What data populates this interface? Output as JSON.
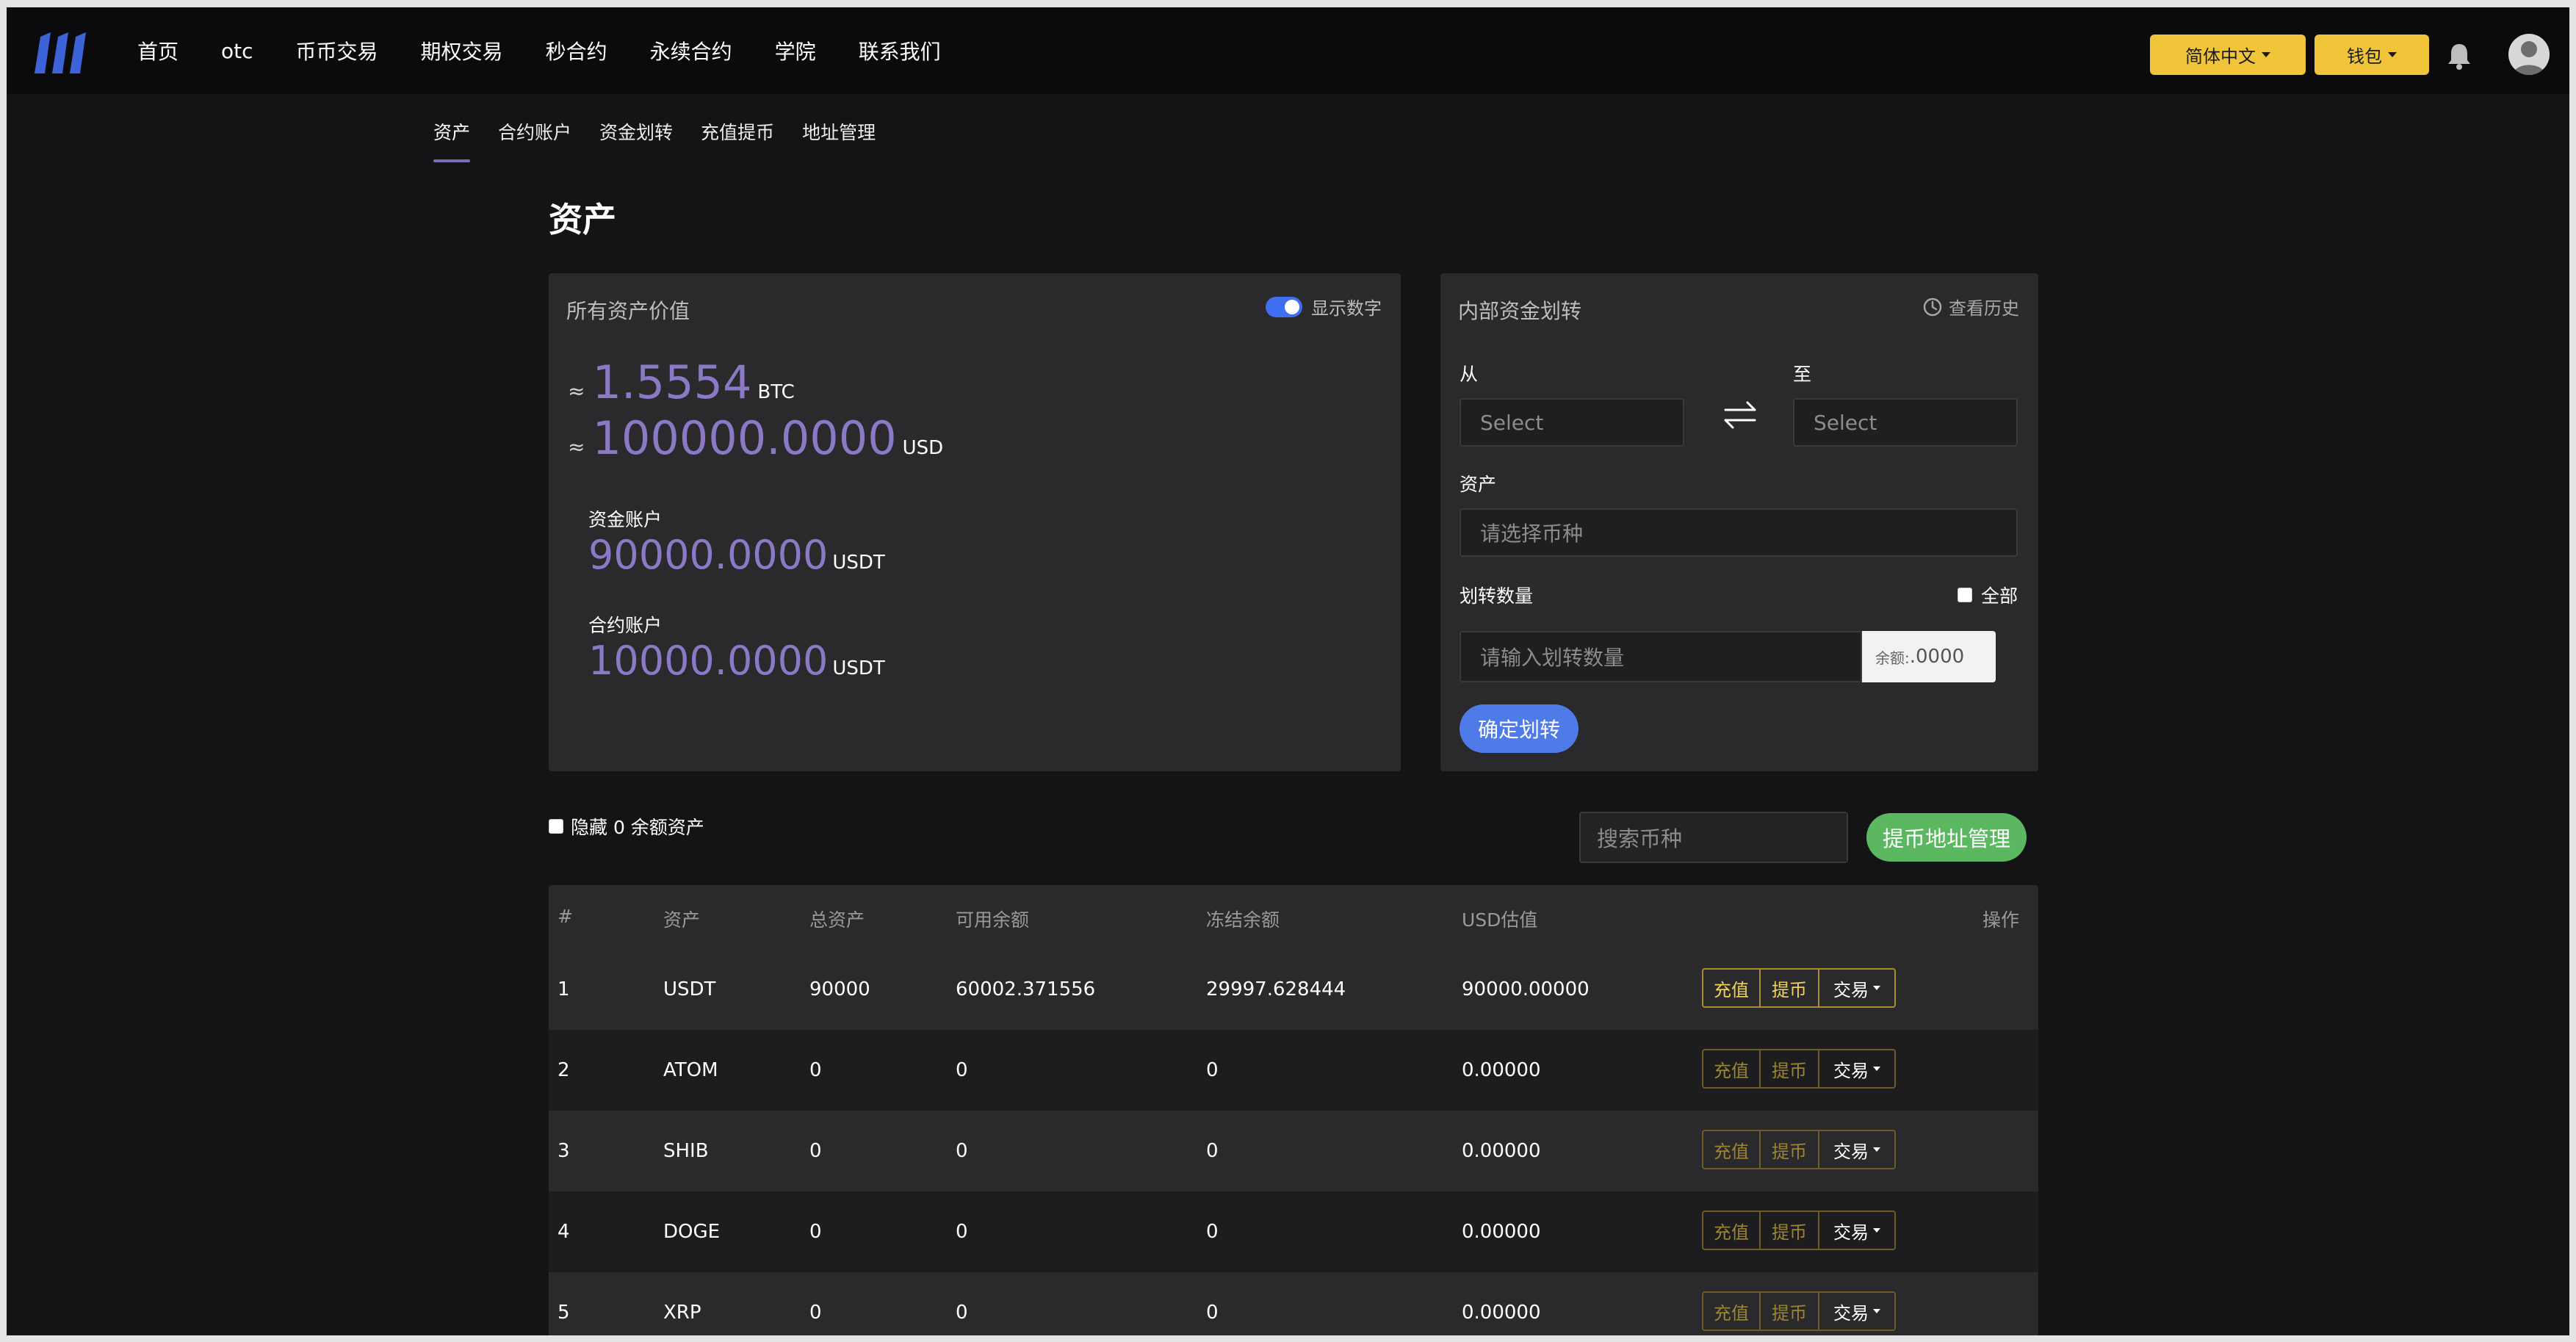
{
  "nav": {
    "items": [
      {
        "label": "首页",
        "name": "nav-home"
      },
      {
        "label": "otc",
        "name": "nav-otc"
      },
      {
        "label": "币币交易",
        "name": "nav-spot"
      },
      {
        "label": "期权交易",
        "name": "nav-options"
      },
      {
        "label": "秒合约",
        "name": "nav-second-contract"
      },
      {
        "label": "永续合约",
        "name": "nav-perpetual"
      },
      {
        "label": "学院",
        "name": "nav-academy"
      },
      {
        "label": "联系我们",
        "name": "nav-contact"
      }
    ],
    "language": "简体中文",
    "wallet": "钱包"
  },
  "subtabs": [
    "资产",
    "合约账户",
    "资金划转",
    "充值提币",
    "地址管理"
  ],
  "page_title": "资产",
  "assets_card": {
    "title": "所有资产价值",
    "toggle_label": "显示数字",
    "approx": "≈",
    "btc_value": "1.5554",
    "btc_unit": "BTC",
    "usd_value": "100000.0000",
    "usd_unit": "USD",
    "fund_account_label": "资金账户",
    "fund_account_value": "90000.0000",
    "fund_account_unit": "USDT",
    "contract_account_label": "合约账户",
    "contract_account_value": "10000.0000",
    "contract_account_unit": "USDT"
  },
  "transfer_card": {
    "title": "内部资金划转",
    "history_label": "查看历史",
    "from_label": "从",
    "to_label": "至",
    "from_placeholder": "Select",
    "to_placeholder": "Select",
    "asset_label": "资产",
    "asset_placeholder": "请选择币种",
    "amount_label": "划转数量",
    "all_label": "全部",
    "amount_placeholder": "请输入划转数量",
    "balance_label": "余额:",
    "balance_value": ".0000",
    "confirm_label": "确定划转"
  },
  "filters": {
    "hide_zero_label": "隐藏 0 余额资产",
    "search_placeholder": "搜索币种",
    "address_btn": "提币地址管理"
  },
  "table": {
    "headers": {
      "index": "#",
      "asset": "资产",
      "total": "总资产",
      "available": "可用余额",
      "frozen": "冻结余额",
      "usd": "USD估值",
      "ops": "操作"
    },
    "actions": {
      "deposit": "充值",
      "withdraw": "提币",
      "trade": "交易"
    },
    "rows": [
      {
        "index": "1",
        "asset": "USDT",
        "total": "90000",
        "available": "60002.371556",
        "frozen": "29997.628444",
        "usd": "90000.00000"
      },
      {
        "index": "2",
        "asset": "ATOM",
        "total": "0",
        "available": "0",
        "frozen": "0",
        "usd": "0.00000"
      },
      {
        "index": "3",
        "asset": "SHIB",
        "total": "0",
        "available": "0",
        "frozen": "0",
        "usd": "0.00000"
      },
      {
        "index": "4",
        "asset": "DOGE",
        "total": "0",
        "available": "0",
        "frozen": "0",
        "usd": "0.00000"
      },
      {
        "index": "5",
        "asset": "XRP",
        "total": "0",
        "available": "0",
        "frozen": "0",
        "usd": "0.00000"
      }
    ]
  },
  "colors": {
    "accent_purple": "#8b79c5",
    "primary_blue": "#4f7be9",
    "success_green": "#5cb860",
    "warning_yellow": "#f0c53a"
  }
}
